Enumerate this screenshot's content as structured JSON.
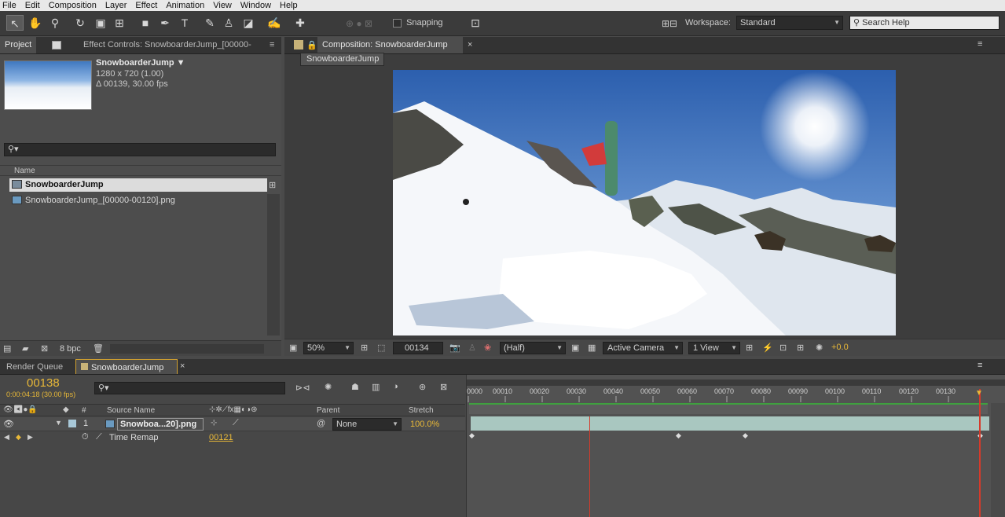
{
  "menu": [
    "File",
    "Edit",
    "Composition",
    "Layer",
    "Effect",
    "Animation",
    "View",
    "Window",
    "Help"
  ],
  "toolbar": {
    "snapping_label": "Snapping",
    "workspace_label": "Workspace:",
    "workspace_value": "Standard",
    "search_placeholder": "Search Help"
  },
  "project_panel": {
    "tab_project": "Project",
    "tab_effect_controls": "Effect Controls: SnowboarderJump_[00000-",
    "comp_name": "SnowboarderJump ▼",
    "comp_size": "1280 x 720 (1.00)",
    "comp_duration": "Δ 00139, 30.00 fps",
    "column_name": "Name",
    "items": [
      {
        "name": "SnowboarderJump",
        "icon": "composition-icon",
        "selected": true
      },
      {
        "name": "SnowboarderJump_[00000-00120].png",
        "icon": "footage-icon",
        "selected": false
      }
    ],
    "bpc": "8 bpc"
  },
  "composition_panel": {
    "tab": "Composition: SnowboarderJump",
    "breadcrumb": "SnowboarderJump",
    "zoom": "50%",
    "frame": "00134",
    "resolution": "(Half)",
    "camera": "Active Camera",
    "view": "1 View",
    "exposure": "+0.0"
  },
  "timeline": {
    "tab_render_queue": "Render Queue",
    "tab_comp": "SnowboarderJump",
    "current_frame": "00138",
    "timecode": "0:00:04:18 (30.00 fps)",
    "column_number": "#",
    "column_source": "Source Name",
    "column_parent": "Parent",
    "column_stretch": "Stretch",
    "layer": {
      "index": "1",
      "name": "Snowboa...20].png",
      "parent": "None",
      "stretch": "100.0%"
    },
    "property": {
      "name": "Time Remap",
      "value": "00121"
    },
    "ruler_ticks": [
      "0000",
      "00010",
      "00020",
      "00030",
      "00040",
      "00050",
      "00060",
      "00070",
      "00080",
      "00090",
      "00100",
      "00110",
      "00120",
      "00130"
    ]
  },
  "colors": {
    "accent_yellow": "#e8b838",
    "layer_bar": "#a9c7c0",
    "playhead": "#d63a2a",
    "work_area": "#3fa03f"
  }
}
